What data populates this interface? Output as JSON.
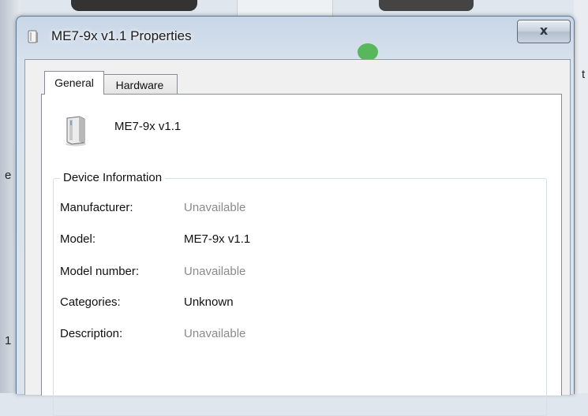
{
  "window": {
    "title": "ME7-9x v1.1 Properties",
    "close_label": "x"
  },
  "background": {
    "left_chars": [
      "e",
      "1"
    ],
    "right_char": "t"
  },
  "tabs": [
    {
      "label": "General",
      "selected": true
    },
    {
      "label": "Hardware",
      "selected": false
    }
  ],
  "device": {
    "name": "ME7-9x v1.1",
    "icon": "device-icon"
  },
  "device_information": {
    "heading": "Device Information",
    "rows": [
      {
        "label": "Manufacturer:",
        "value": "Unavailable",
        "muted": true
      },
      {
        "label": "Model:",
        "value": "ME7-9x v1.1",
        "muted": false
      },
      {
        "label": "Model number:",
        "value": "Unavailable",
        "muted": true
      },
      {
        "label": "Categories:",
        "value": "Unknown",
        "muted": false
      },
      {
        "label": "Description:",
        "value": "Unavailable",
        "muted": true
      }
    ]
  },
  "colors": {
    "muted_value": "#8a8a8a",
    "text": "#111111"
  }
}
